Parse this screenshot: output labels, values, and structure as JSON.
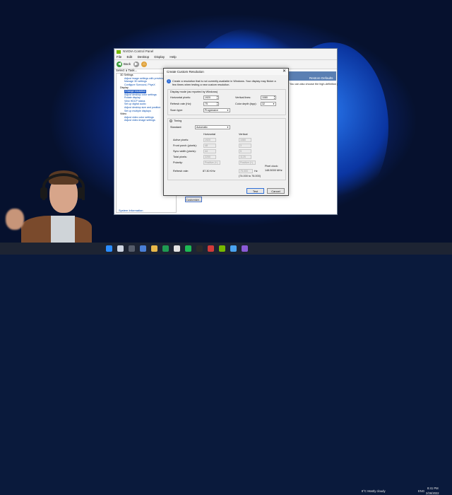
{
  "control_panel": {
    "title": "NVIDIA Control Panel",
    "menu": [
      "File",
      "Edit",
      "Desktop",
      "Display",
      "Help"
    ],
    "back_label": "Back",
    "task_label": "Select a Task...",
    "tree": [
      {
        "type": "cat",
        "label": "3D Settings"
      },
      {
        "type": "sub",
        "label": "Adjust image settings with preview"
      },
      {
        "type": "sub",
        "label": "Manage 3D settings"
      },
      {
        "type": "sub",
        "label": "Configure Surround, PhysX"
      },
      {
        "type": "cat",
        "label": "Display"
      },
      {
        "type": "sub",
        "label": "Change resolution",
        "selected": true
      },
      {
        "type": "sub",
        "label": "Adjust desktop color settings"
      },
      {
        "type": "sub",
        "label": "Rotate display"
      },
      {
        "type": "sub",
        "label": "View HDCP status"
      },
      {
        "type": "sub",
        "label": "Set up digital audio"
      },
      {
        "type": "sub",
        "label": "Adjust desktop size and position"
      },
      {
        "type": "sub",
        "label": "Set up multiple displays"
      },
      {
        "type": "cat",
        "label": "Video"
      },
      {
        "type": "sub",
        "label": "Adjust video color settings"
      },
      {
        "type": "sub",
        "label": "Adjust video image settings"
      }
    ],
    "system_info": "System Information",
    "restore_defaults": "Restore Defaults",
    "right_text": "You can also choose the high-definition (",
    "customize_button": "Customize..."
  },
  "dialog": {
    "title": "Create Custom Resolution",
    "close": "✕",
    "message": "Create a resolution that is not currently available in Windows. Your display may flicker a few times when testing a new custom resolution.",
    "display_mode_label": "Display mode (as reported by Windows)",
    "horizontal_pixels_label": "Horizontal pixels:",
    "horizontal_pixels_value": "1920",
    "vertical_lines_label": "Vertical lines:",
    "vertical_lines_value": "1080",
    "refresh_rate_label": "Refresh rate (Hz):",
    "refresh_rate_value": "75",
    "color_depth_label": "Color depth (bpp):",
    "color_depth_value": "32",
    "scan_type_label": "Scan type:",
    "scan_type_value": "Progressive",
    "timing_label": "Timing",
    "standard_label": "Standard:",
    "standard_value": "Automatic",
    "horizontal_header": "Horizontal",
    "vertical_header": "Vertical",
    "rows": [
      {
        "label": "Active pixels:",
        "h": "1920",
        "v": "1080"
      },
      {
        "label": "Front porch (pixels):",
        "h": "48",
        "v": "3"
      },
      {
        "label": "Sync width (pixels):",
        "h": "44",
        "v": "5"
      },
      {
        "label": "Total pixels:",
        "h": "2200",
        "v": "1125"
      },
      {
        "label": "Polarity:",
        "h": "Positive (+)",
        "v": "Positive (+)"
      }
    ],
    "refresh_rate_row_label": "Refresh rate:",
    "refresh_khz": "87.30 KHz",
    "refresh_hz": "75.000",
    "hz_unit": "Hz",
    "refresh_note": "(74.000 to 76.000)",
    "pixel_clock_label": "Pixel clock:",
    "pixel_clock_value": "148.5000 MHz",
    "test_button": "Test",
    "cancel_button": "Cancel"
  },
  "taskbar": {
    "weather": "8°C  Mostly cloudy",
    "language": "ENG",
    "time": "8:41 PM",
    "date": "2/26/2022"
  }
}
